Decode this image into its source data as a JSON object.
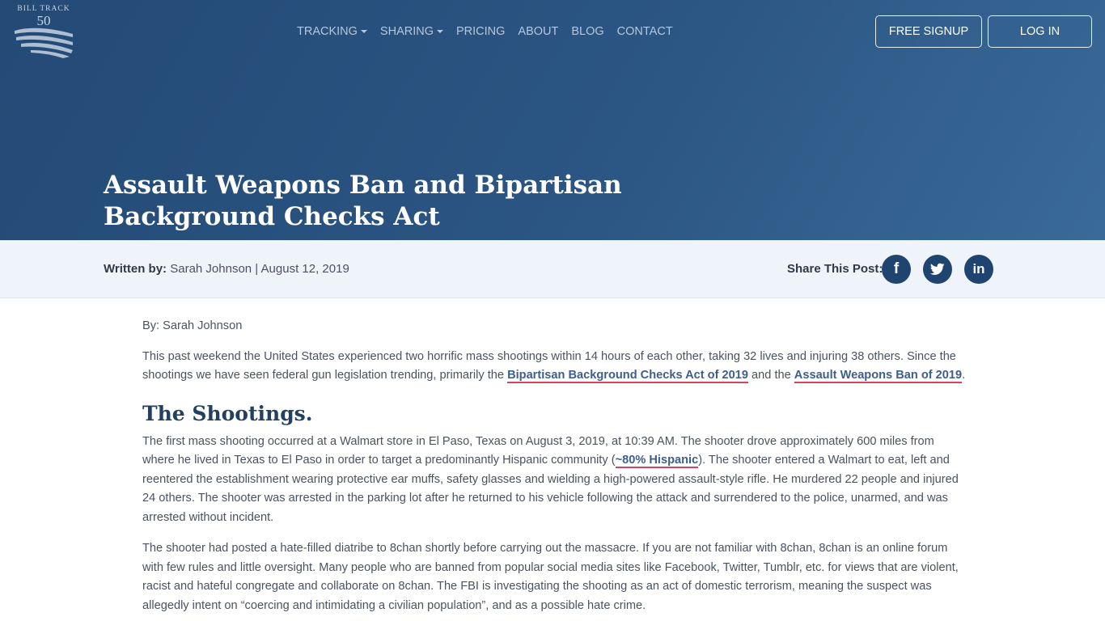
{
  "brand": {
    "line1": "BILL TRACK",
    "line2": "50"
  },
  "nav": {
    "items": [
      {
        "label": "TRACKING"
      },
      {
        "label": "SHARING"
      },
      {
        "label": "PRICING"
      },
      {
        "label": "ABOUT"
      },
      {
        "label": "BLOG"
      },
      {
        "label": "CONTACT"
      }
    ],
    "signup": "FREE SIGNUP",
    "login": "LOG IN"
  },
  "post": {
    "title": "Assault Weapons Ban and Bipartisan Background Checks Act",
    "written_by_label": "Written by:",
    "author_date": "Sarah Johnson | August 12, 2019",
    "share_label": "Share This Post:"
  },
  "social": {
    "facebook": "f",
    "twitter": "twitter-icon",
    "linkedin": "in"
  },
  "article": {
    "by": "By: Sarah Johnson",
    "intro_before": "This past weekend the United States experienced two horrific mass shootings within 14 hours of each other, taking 32 lives and injuring 38 others. Since the shootings we have seen federal gun legislation trending, primarily the ",
    "link1": "Bipartisan Background Checks Act of 2019",
    "intro_mid": " and the ",
    "link2": "Assault Weapons Ban of 2019",
    "intro_end": ".",
    "heading": "The Shootings.",
    "p1_before": "The first mass shooting occurred at a Walmart store in El Paso, Texas on August 3, 2019, at 10:39 AM. The shooter drove approximately 600 miles from where he lived in Texas to El Paso in order to target a predominantly Hispanic community (",
    "link3": "~80% Hispanic",
    "p1_after": "). The shooter entered a Walmart to eat, left and reentered the establishment wearing protective ear muffs, safety glasses and wielding a high-powered assault-style rifle. He murdered 22 people and injured 24 others. The shooter was arrested in the parking lot after he returned to his vehicle following the attack and surrendered to the police, unarmed, and was arrested without incident.",
    "p2": "The shooter had posted a hate-filled diatribe to 8chan shortly before carrying out the massacre. If you are not familiar with 8chan, 8chan is an online forum with few rules and little oversight. Many people who are banned from popular social media sites like Facebook, Twitter, Tumblr, etc. for views that are violent, racist and hateful congregate and collaborate on 8chan. The FBI is investigating the shooting as an act of domestic terrorism, meaning the suspect was allegedly intent on “coercing and intimidating a civilian population”, and as a possible hate crime."
  },
  "colors": {
    "hero": "#2b5583",
    "accent_underline": "#d0465d",
    "social_bg": "#1f4470"
  }
}
